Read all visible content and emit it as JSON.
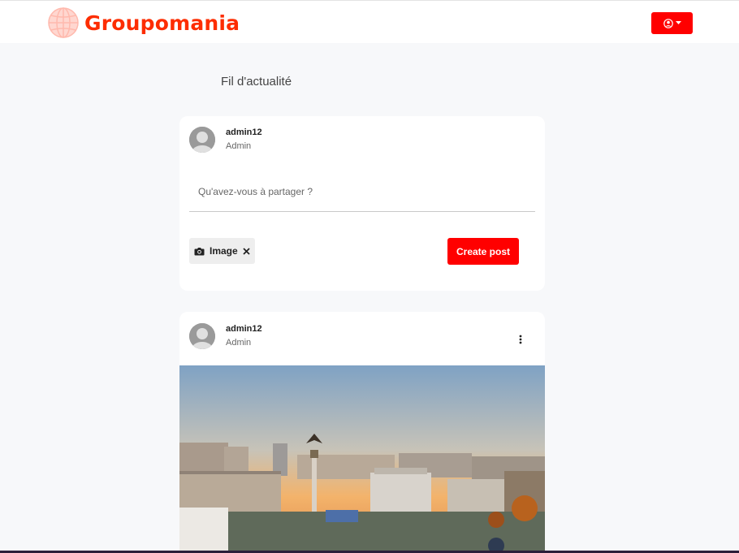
{
  "header": {
    "brand": "Groupomania",
    "logo_icon": "globe-icon",
    "user_menu_icon": "user-circle-icon",
    "accent": "#ff0000"
  },
  "feed": {
    "title": "Fil d'actualité"
  },
  "composer": {
    "author": "admin12",
    "role": "Admin",
    "placeholder": "Qu'avez-vous à partager ?",
    "image_label": "Image",
    "create_label": "Create post"
  },
  "post": {
    "author": "admin12",
    "role": "Admin",
    "menu_icon": "kebab-menu-icon",
    "image_description": "photo"
  }
}
